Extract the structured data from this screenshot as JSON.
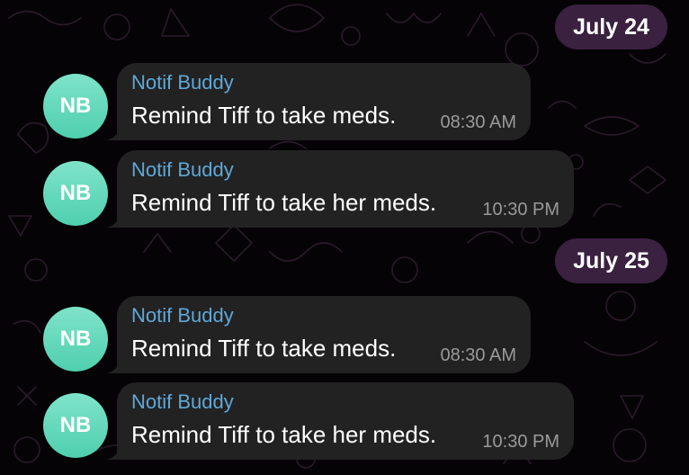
{
  "colors": {
    "background": "#050305",
    "date_pill": "#3a2140",
    "bubble": "#222222",
    "sender": "#5fa8d8",
    "avatar": "#5ed6b6"
  },
  "dates": [
    {
      "label": "July 24"
    },
    {
      "label": "July 25"
    }
  ],
  "messages": [
    {
      "avatar": "NB",
      "sender": "Notif Buddy",
      "text": "Remind Tiff to take meds.",
      "time": "08:30 AM"
    },
    {
      "avatar": "NB",
      "sender": "Notif Buddy",
      "text": "Remind Tiff to take her meds.",
      "time": "10:30 PM"
    },
    {
      "avatar": "NB",
      "sender": "Notif Buddy",
      "text": "Remind Tiff to take meds.",
      "time": "08:30 AM"
    },
    {
      "avatar": "NB",
      "sender": "Notif Buddy",
      "text": "Remind Tiff to take her meds.",
      "time": "10:30 PM"
    }
  ]
}
